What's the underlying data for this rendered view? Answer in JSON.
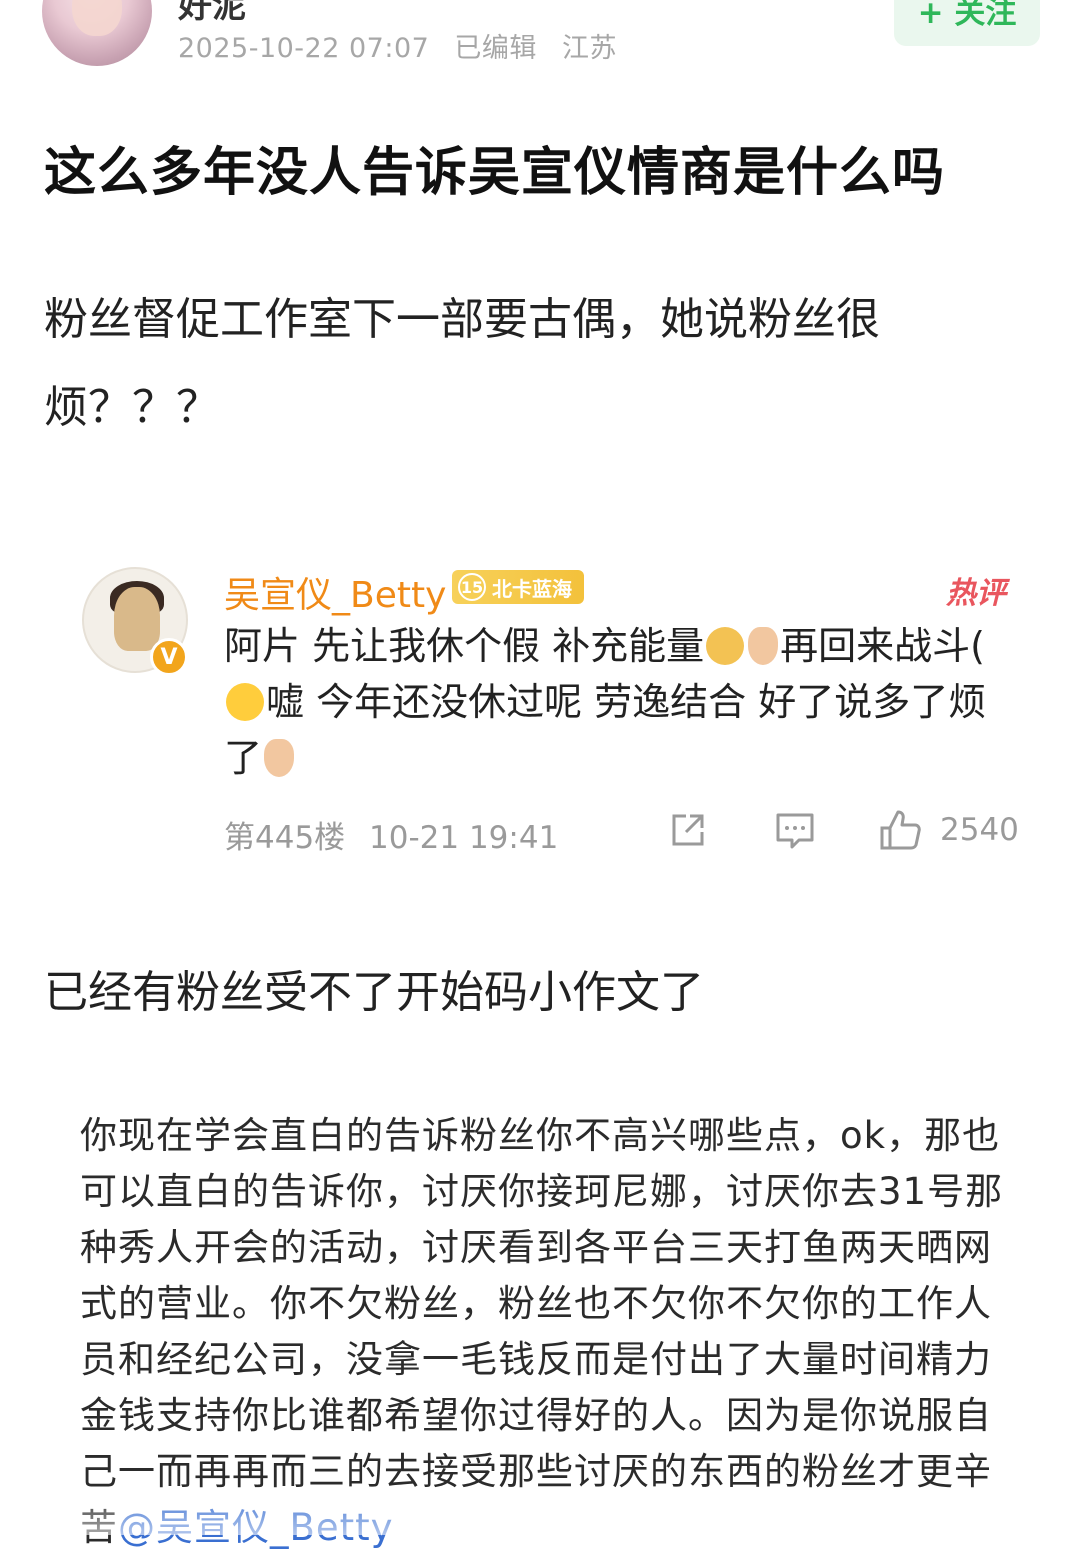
{
  "header": {
    "username": "好泥",
    "timestamp": "2025-10-22 07:07",
    "edited": "已编辑",
    "location": "江苏",
    "follow_label": "+ 关注"
  },
  "post": {
    "title": "这么多年没人告诉吴宣仪情商是什么吗",
    "paragraph1": "粉丝督促工作室下一部要古偶，她说粉丝很烦？？？",
    "paragraph2": "已经有粉丝受不了开始码小作文了"
  },
  "embedded_comment": {
    "author": "吴宣仪_Betty",
    "fan_level": "15",
    "fan_badge": "北卡蓝海",
    "hot_tag": "热评",
    "text_part1": "阿片 先让我休个假 补充能量",
    "text_part2": "再回来战斗(",
    "text_part3": "嘘 今年还没休过呢 劳逸结合 好了说多了烦了",
    "floor": "第445楼",
    "time": "10-21 19:41",
    "like_count": "2540",
    "icons": [
      "share-icon",
      "comment-icon",
      "like-icon",
      "verified-v-icon"
    ]
  },
  "quote_text": {
    "body": "你现在学会直白的告诉粉丝你不高兴哪些点，ok，那也可以直白的告诉你，讨厌你接珂尼娜，讨厌你去31号那种秀人开会的活动，讨厌看到各平台三天打鱼两天晒网式的营业。你不欠粉丝，粉丝也不欠你不欠你的工作人员和经纪公司，没拿一毛钱反而是付出了大量时间精力金钱支持你比谁都希望你过得好的人。因为是你说服自己一而再再而三的去接受那些讨厌的东西的粉丝才更辛苦",
    "mention": "@吴宣仪_Betty"
  },
  "colors": {
    "accent_follow": "#2fb75a",
    "comment_author": "#f08a17",
    "hot_tag": "#e9565e",
    "mention": "#3a6fd1"
  }
}
